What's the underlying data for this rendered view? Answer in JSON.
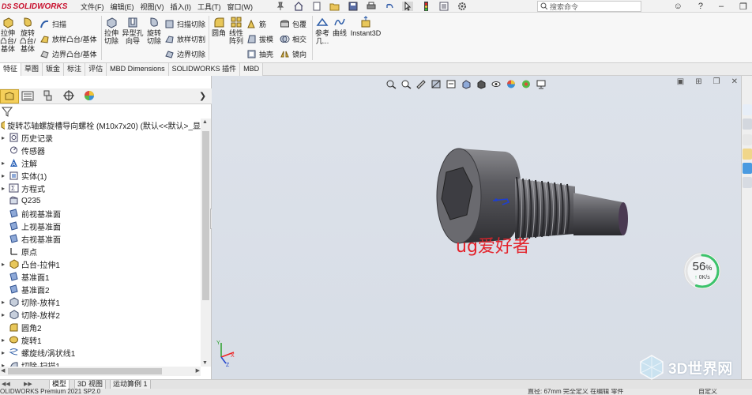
{
  "app": {
    "brand": "SOLIDWORKS",
    "brand_prefix": "DS"
  },
  "menu": {
    "items": [
      "文件(F)",
      "编辑(E)",
      "视图(V)",
      "插入(I)",
      "工具(T)",
      "窗口(W)"
    ]
  },
  "search": {
    "placeholder": "搜索命令"
  },
  "ribbon": {
    "extrude": "拉伸\n凸台/\n基体",
    "revolve": "旋转\n凸台/\n基体",
    "sweep": "扫描",
    "loft": "放样凸台/基体",
    "boundary": "边界凸台/基体",
    "extrude_cut": "拉伸\n切除",
    "hole_wizard": "异型孔\n向导",
    "revolve_cut": "旋转\n切除",
    "swept_cut": "扫描切除",
    "lofted_cut": "放样切割",
    "boundary_cut": "边界切除",
    "fillet": "圆角",
    "linear_pattern": "线性\n阵列",
    "rib": "筋",
    "draft": "拔模",
    "shell": "抽壳",
    "wrap": "包覆",
    "intersect": "相交",
    "mirror": "镜向",
    "ref_geometry": "参考\n几...",
    "curves": "曲线",
    "instant3d": "Instant3D"
  },
  "command_tabs": [
    "特征",
    "草图",
    "钣金",
    "标注",
    "评估",
    "MBD Dimensions",
    "SOLIDWORKS 插件",
    "MBD"
  ],
  "feature_tree": {
    "root": "旋转芯轴螺旋槽导向螺栓 (M10x7x20) (默认<<默认>_显",
    "items": [
      {
        "label": "历史记录",
        "arrow": "▸",
        "icon": "history-icon"
      },
      {
        "label": "传感器",
        "arrow": "",
        "icon": "sensor-icon"
      },
      {
        "label": "注解",
        "arrow": "▸",
        "icon": "annotation-icon"
      },
      {
        "label": "实体(1)",
        "arrow": "▸",
        "icon": "solid-bodies-icon"
      },
      {
        "label": "方程式",
        "arrow": "▸",
        "icon": "equations-icon"
      },
      {
        "label": "Q235",
        "arrow": "",
        "icon": "material-icon"
      },
      {
        "label": "前视基准面",
        "arrow": "",
        "icon": "plane-icon"
      },
      {
        "label": "上视基准面",
        "arrow": "",
        "icon": "plane-icon"
      },
      {
        "label": "右视基准面",
        "arrow": "",
        "icon": "plane-icon"
      },
      {
        "label": "原点",
        "arrow": "",
        "icon": "origin-icon"
      },
      {
        "label": "凸台-拉伸1",
        "arrow": "▸",
        "icon": "extrude-feature-icon"
      },
      {
        "label": "基准面1",
        "arrow": "",
        "icon": "plane-icon"
      },
      {
        "label": "基准面2",
        "arrow": "",
        "icon": "plane-icon"
      },
      {
        "label": "切除-放样1",
        "arrow": "▸",
        "icon": "cut-loft-icon"
      },
      {
        "label": "切除-放样2",
        "arrow": "▸",
        "icon": "cut-loft-icon"
      },
      {
        "label": "圆角2",
        "arrow": "",
        "icon": "fillet-feature-icon"
      },
      {
        "label": "旋转1",
        "arrow": "▸",
        "icon": "revolve-feature-icon"
      },
      {
        "label": "螺旋线/涡状线1",
        "arrow": "▸",
        "icon": "helix-icon"
      },
      {
        "label": "切除-扫描1",
        "arrow": "▸",
        "icon": "cut-sweep-icon"
      }
    ]
  },
  "viewport": {
    "watermark_text": "ug爱好者"
  },
  "gauge": {
    "percent": 56,
    "percent_suffix": "%",
    "rate": "0K/s",
    "color": "#3cc36b"
  },
  "bottom_tabs": [
    "模型",
    "3D 视图",
    "运动算例 1"
  ],
  "status": {
    "left": "OLIDWORKS Premium 2021 SP2.0",
    "right": "直径: 67mm  完全定义  在编辑 零件",
    "custom": "自定义"
  },
  "watermark": {
    "site": "3D世界网"
  },
  "colors": {
    "accent_red": "#e4232b",
    "selected_tab": "#f5cf5a"
  }
}
